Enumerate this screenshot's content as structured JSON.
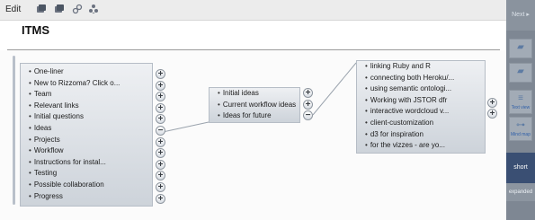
{
  "toolbar": {
    "edit_label": "Edit",
    "icons": [
      "stack-icon",
      "stack-alt-icon",
      "link-icon",
      "network-icon"
    ]
  },
  "page": {
    "title": "ITMS"
  },
  "mindmap": {
    "root_items": [
      "One-liner",
      "New to Rizzoma? Click o...",
      "Team",
      "Relevant links",
      "Initial questions",
      "Ideas",
      "Projects",
      "Workflow",
      "Instructions for instal...",
      "Testing",
      "Possible collaboration",
      "Progress"
    ],
    "ideas_items": [
      "Initial ideas",
      "Current workflow ideas",
      "Ideas for future"
    ],
    "future_items": [
      "linking Ruby and R",
      "connecting both Heroku/...",
      "using semantic ontologi...",
      "Working with JSTOR dfr",
      "interactive wordcloud v...",
      "client-customization",
      "d3 for inspiration",
      "for the vizzes - are yo..."
    ]
  },
  "sidebar": {
    "next_label": "Next ▸",
    "text_view_label": "Text view",
    "mind_map_label": "Mind map",
    "short_label": "short",
    "expanded_label": "expanded"
  }
}
